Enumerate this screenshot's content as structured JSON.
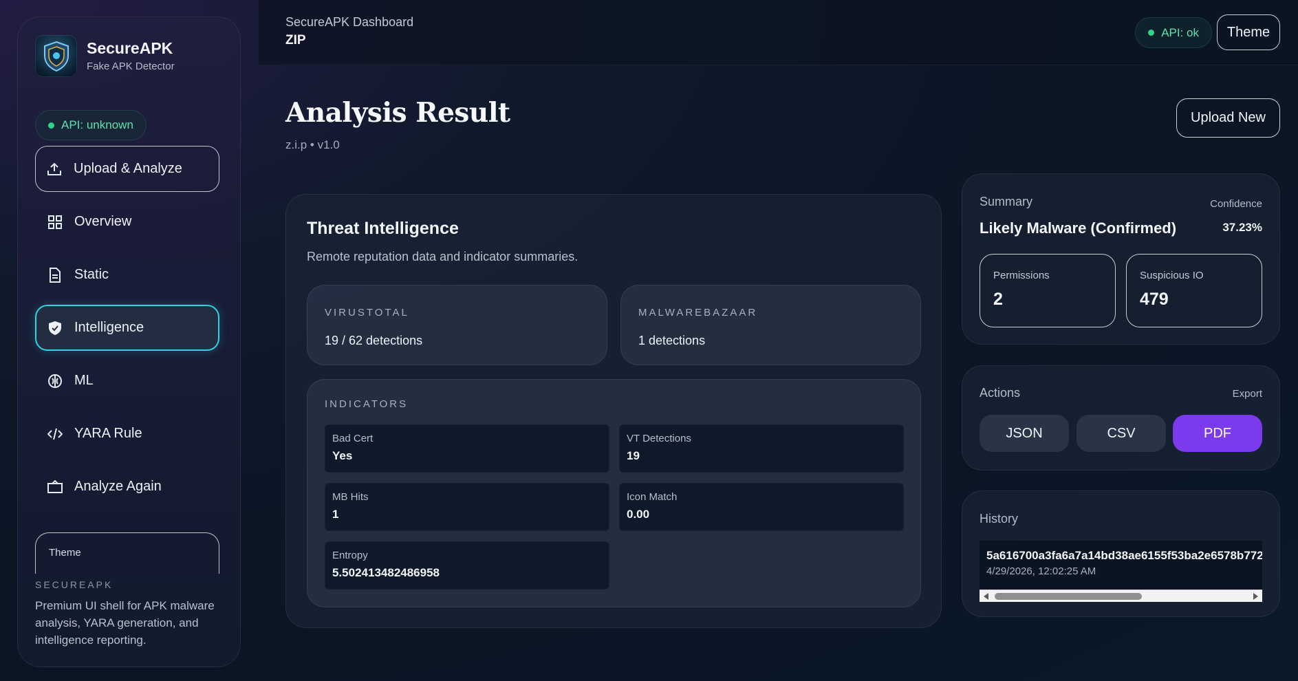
{
  "sidebar": {
    "brand": {
      "name": "SecureAPK",
      "subtitle": "Fake APK Detector"
    },
    "api_status": "API: unknown",
    "nav": [
      {
        "label": "Upload & Analyze",
        "icon": "upload-icon"
      },
      {
        "label": "Overview",
        "icon": "grid-icon"
      },
      {
        "label": "Static",
        "icon": "document-icon"
      },
      {
        "label": "Intelligence",
        "icon": "shield-icon",
        "active": true
      },
      {
        "label": "ML",
        "icon": "brain-icon"
      },
      {
        "label": "YARA Rule",
        "icon": "code-icon"
      },
      {
        "label": "Analyze Again",
        "icon": "refresh-icon"
      }
    ],
    "theme_label": "Theme",
    "footer": {
      "eyebrow": "SECUREAPK",
      "text": "Premium UI shell for APK malware analysis, YARA generation, and intelligence reporting."
    }
  },
  "topbar": {
    "breadcrumb": "SecureAPK Dashboard",
    "file": "ZIP",
    "api_status": "API: ok",
    "theme_button": "Theme"
  },
  "main": {
    "title": "Analysis Result",
    "subtitle": "z.i.p • v1.0",
    "upload_new": "Upload New"
  },
  "threat": {
    "title": "Threat Intelligence",
    "description": "Remote reputation data and indicator summaries.",
    "virustotal": {
      "label": "VIRUSTOTAL",
      "value": "19 / 62 detections"
    },
    "malwarebazaar": {
      "label": "MALWAREBAZAAR",
      "value": "1 detections"
    },
    "indicators": {
      "label": "INDICATORS",
      "items": [
        {
          "label": "Bad Cert",
          "value": "Yes"
        },
        {
          "label": "VT Detections",
          "value": "19"
        },
        {
          "label": "MB Hits",
          "value": "1"
        },
        {
          "label": "Icon Match",
          "value": "0.00"
        },
        {
          "label": "Entropy",
          "value": "5.502413482486958"
        }
      ]
    }
  },
  "summary": {
    "label": "Summary",
    "confidence_label": "Confidence",
    "verdict": "Likely Malware (Confirmed)",
    "confidence": "37.23%",
    "permissions_label": "Permissions",
    "permissions": "2",
    "suspicious_label": "Suspicious IO",
    "suspicious": "479"
  },
  "actions": {
    "label": "Actions",
    "export_label": "Export",
    "buttons": [
      "JSON",
      "CSV",
      "PDF"
    ]
  },
  "history": {
    "label": "History",
    "entries": [
      {
        "hash": "5a616700a3fa6a7a14bd38ae6155f53ba2e6578b772",
        "time": "4/29/2026, 12:02:25 AM"
      }
    ]
  },
  "colors": {
    "accent": "#7c3aed",
    "active_border": "#2fd3e3",
    "status_ok": "#2fd48c"
  }
}
